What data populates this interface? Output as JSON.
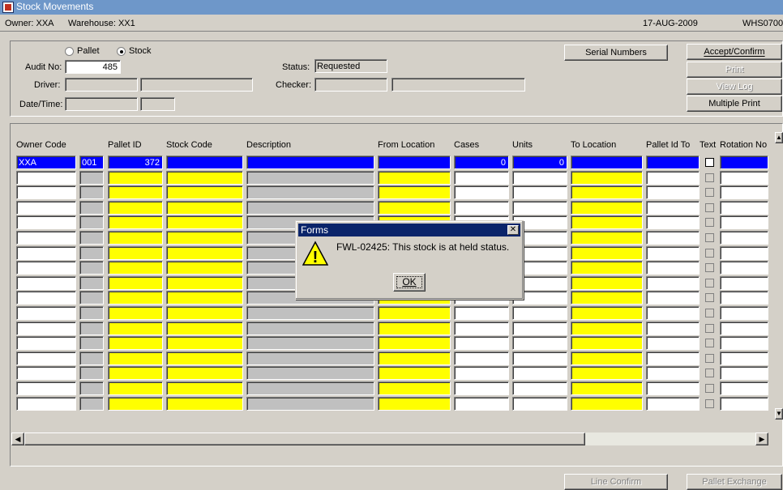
{
  "window": {
    "title": "Stock Movements"
  },
  "infobar": {
    "owner": "Owner:  XXA",
    "warehouse": "Warehouse:  XX1",
    "date": "17-AUG-2009",
    "code": "WHS0700"
  },
  "form": {
    "radio_pallet": "Pallet",
    "radio_stock": "Stock",
    "audit_label": "Audit No:",
    "audit_value": "485",
    "driver_label": "Driver:",
    "datetime_label": "Date/Time:",
    "status_label": "Status:",
    "status_value": "Requested",
    "checker_label": "Checker:"
  },
  "buttons": {
    "serial_numbers": "Serial Numbers",
    "accept_confirm": "Accept/Confirm",
    "print": "Print",
    "view_log": "View Log",
    "multiple_print": "Multiple Print",
    "line_confirm": "Line Confirm",
    "pallet_exchange": "Pallet Exchange"
  },
  "table": {
    "headers": {
      "owner_code": "Owner Code",
      "pallet_id": "Pallet ID",
      "stock_code": "Stock Code",
      "description": "Description",
      "from_location": "From Location",
      "cases": "Cases",
      "units": "Units",
      "to_location": "To Location",
      "pallet_id_to": "Pallet Id To",
      "text": "Text",
      "rotation_no": "Rotation No"
    },
    "first_row": {
      "owner": "XXA",
      "seq": "001",
      "pallet_id": "372",
      "cases": "0",
      "units": "0"
    }
  },
  "dialog": {
    "title": "Forms",
    "message": "FWL-02425:  This stock is at held status.",
    "ok_label": "OK",
    "close_glyph": "✕",
    "warning_glyph": "!"
  },
  "icons": {
    "app": "oracle-forms-icon",
    "warning": "warning-icon"
  }
}
